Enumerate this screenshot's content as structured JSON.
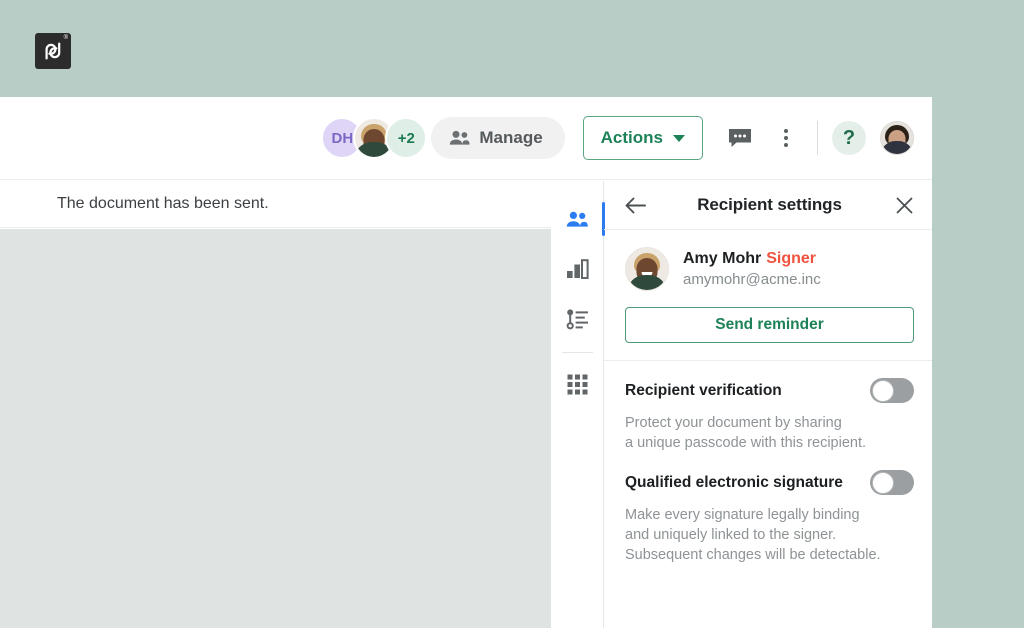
{
  "brand": {
    "logo_text": "pd",
    "registered_mark": "®",
    "logo_name": "pandadoc-logo"
  },
  "toolbar": {
    "avatars": [
      {
        "type": "initials",
        "label": "DH",
        "name": "avatar-dh"
      },
      {
        "type": "photo",
        "label": "",
        "name": "avatar-photo"
      },
      {
        "type": "count",
        "label": "+2",
        "name": "avatar-overflow-count"
      }
    ],
    "manage_label": "Manage",
    "actions_label": "Actions",
    "comment_icon": "comment-icon",
    "kebab_icon": "more-vertical-icon",
    "help_label": "?",
    "help_icon": "help-icon",
    "user_avatar": "user-avatar"
  },
  "banner": {
    "message": "The document has been sent."
  },
  "rail": {
    "items": [
      {
        "name": "sidebar-item-recipients",
        "icon": "people-icon",
        "active": true
      },
      {
        "name": "sidebar-item-analytics",
        "icon": "bar-chart-icon",
        "active": false
      },
      {
        "name": "sidebar-item-activity",
        "icon": "activity-list-icon",
        "active": false
      },
      {
        "name": "sidebar-item-apps",
        "icon": "grid-apps-icon",
        "active": false
      }
    ]
  },
  "panel": {
    "title": "Recipient settings",
    "back_icon": "arrow-left-icon",
    "close_icon": "close-icon",
    "recipient": {
      "name": "Amy Mohr",
      "role": "Signer",
      "email": "amymohr@acme.inc",
      "avatar_name": "recipient-avatar"
    },
    "send_reminder_label": "Send reminder",
    "settings": [
      {
        "name": "recipient-verification",
        "title": "Recipient verification",
        "description": "Protect your document by sharing\na unique passcode with this recipient.",
        "toggle_state": "off"
      },
      {
        "name": "qualified-electronic-signature",
        "title": "Qualified electronic signature",
        "description": "Make every signature legally binding\nand uniquely linked to the signer.\nSubsequent changes will be detectable.",
        "toggle_state": "off"
      }
    ]
  },
  "colors": {
    "page_background": "#b7cdc6",
    "accent_green": "#1d8257",
    "role_red": "#f0533e",
    "active_blue": "#2b7cf0",
    "canvas_gray": "#dfe3e2"
  }
}
